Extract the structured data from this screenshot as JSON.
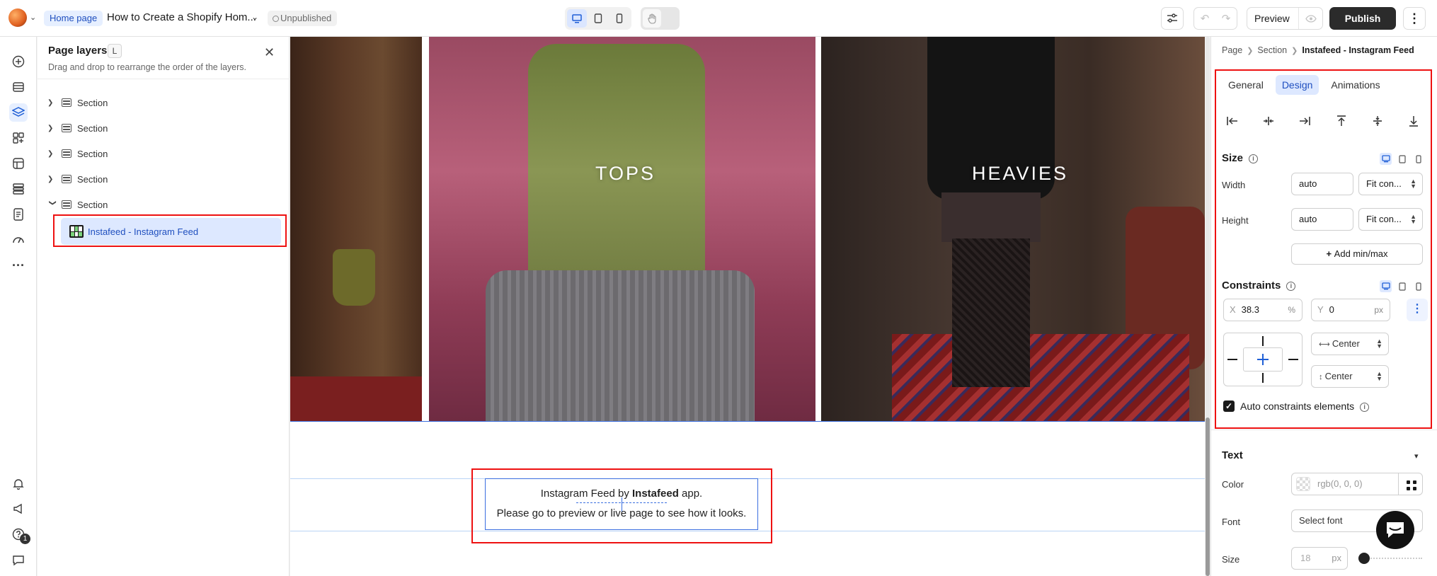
{
  "topbar": {
    "home_chip": "Home page",
    "page_name": "How to Create a Shopify Hom...",
    "status": "Unpublished",
    "preview_label": "Preview",
    "publish_label": "Publish"
  },
  "rail": {
    "notification_count": "1"
  },
  "layers": {
    "title": "Page layers",
    "shortcut": "L",
    "subtitle": "Drag and drop to rearrange the order of the layers.",
    "sections": [
      "Section",
      "Section",
      "Section",
      "Section",
      "Section"
    ],
    "child": "Instafeed - Instagram Feed"
  },
  "canvas": {
    "label_tops": "TOPS",
    "label_heavies": "HEAVIES",
    "insta_prefix": "Instagram Feed by ",
    "insta_bold": "Instafeed",
    "insta_suffix": " app.",
    "insta_line2": "Please go to preview or live page to see how it looks."
  },
  "inspector": {
    "breadcrumb": [
      "Page",
      "Section",
      "Instafeed - Instagram Feed"
    ],
    "tabs": [
      "General",
      "Design",
      "Animations"
    ],
    "active_tab": "Design",
    "size_title": "Size",
    "width_label": "Width",
    "width_value": "auto",
    "width_mode": "Fit con...",
    "height_label": "Height",
    "height_value": "auto",
    "height_mode": "Fit con...",
    "add_minmax": "Add min/max",
    "constraints_title": "Constraints",
    "x_label": "X",
    "x_value": "38.3",
    "x_unit": "%",
    "y_label": "Y",
    "y_value": "0",
    "y_unit": "px",
    "h_align": "Center",
    "v_align": "Center",
    "auto_constraints": "Auto constraints elements",
    "text_title": "Text",
    "color_label": "Color",
    "color_value": "rgb(0, 0, 0)",
    "font_label": "Font",
    "font_value": "Select font",
    "size_label": "Size",
    "size_value": "18",
    "size_unit": "px"
  },
  "colors": {
    "accent": "#1f5fd6",
    "highlight": "#dde8ff",
    "annotation": "#e11111"
  }
}
